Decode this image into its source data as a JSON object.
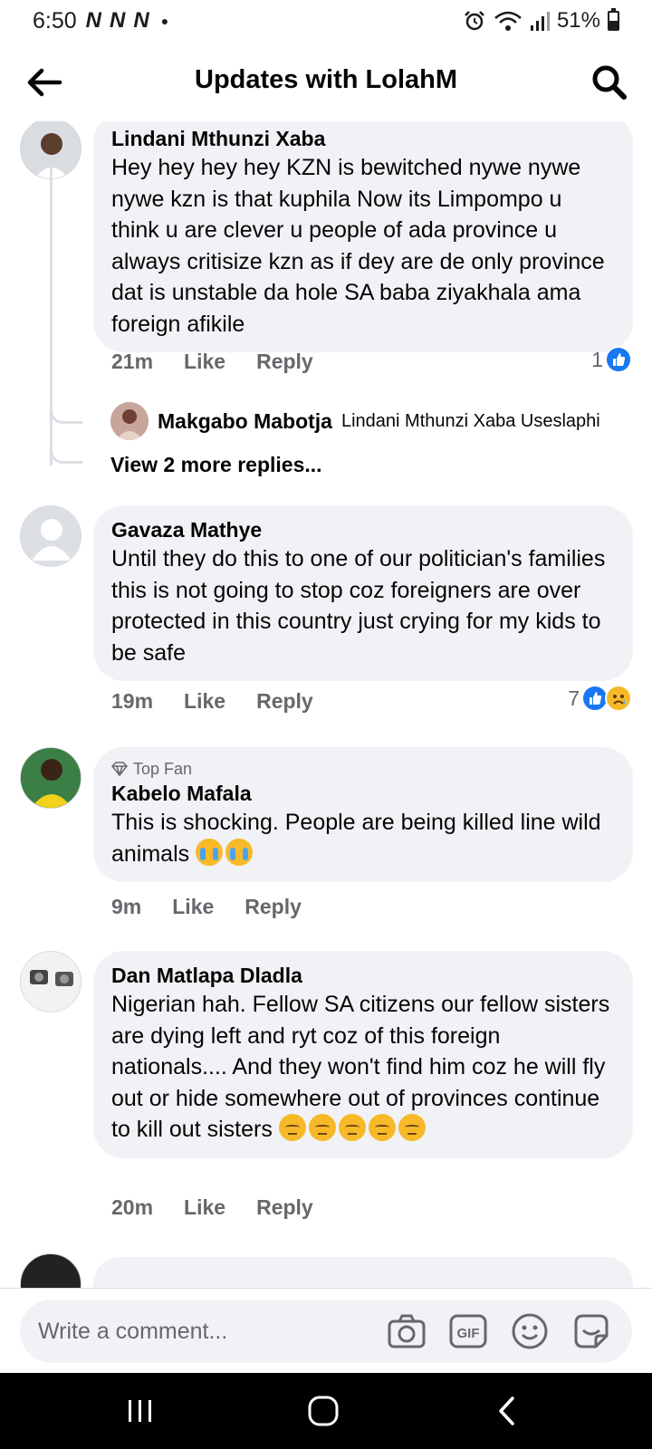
{
  "status_bar": {
    "time": "6:50",
    "notifications": [
      "N",
      "N",
      "N"
    ],
    "battery": "51%",
    "battery_level": 0.51
  },
  "header": {
    "title": "Updates with LolahM",
    "back_icon": "arrow-left-icon",
    "search_icon": "search-icon"
  },
  "comments": [
    {
      "author": "Lindani Mthunzi Xaba",
      "text": "Hey hey hey hey KZN is   bewitched  nywe nywe nywe kzn is that  kuphila Now its Limpompo    u think u are clever u people of ada province u always critisize kzn as if dey are de only  province  dat is unstable da hole SA baba ziyakhala ama foreign  afikile",
      "time": "21m",
      "like": "Like",
      "reply": "Reply",
      "reaction_count": "1",
      "replies": {
        "reply_author": "Makgabo Mabotja",
        "reply_snippet": "Lindani Mthunzi Xaba Useslaphi",
        "view_more": "View 2 more replies..."
      }
    },
    {
      "author": "Gavaza Mathye",
      "text": "Until they do this to one of our politician's families this is not going to stop coz foreigners are over protected in this country just crying for my kids to be safe",
      "time": "19m",
      "like": "Like",
      "reply": "Reply",
      "reaction_count": "7"
    },
    {
      "badge": "Top Fan",
      "author": "Kabelo Mafala",
      "text": "This is shocking. People are being killed line wild animals",
      "time": "9m",
      "like": "Like",
      "reply": "Reply"
    },
    {
      "author": "Dan Matlapa Dladla",
      "text": "Nigerian hah.  Fellow SA citizens our fellow sisters are dying left and ryt coz of this foreign nationals.... And they won't find him coz he will fly out or hide somewhere out of provinces continue to kill out sisters",
      "time": "20m",
      "like": "Like",
      "reply": "Reply"
    }
  ],
  "composer": {
    "placeholder": "Write a comment...",
    "icons": [
      "camera-icon",
      "gif-icon",
      "emoji-icon",
      "sticker-icon"
    ],
    "gif_label": "GIF"
  },
  "nav": {
    "icons": [
      "recent-apps-icon",
      "home-icon",
      "back-icon"
    ]
  },
  "colors": {
    "accent": "#1877f2",
    "bubble": "#f0f2f5",
    "secondary_text": "#65676b"
  }
}
